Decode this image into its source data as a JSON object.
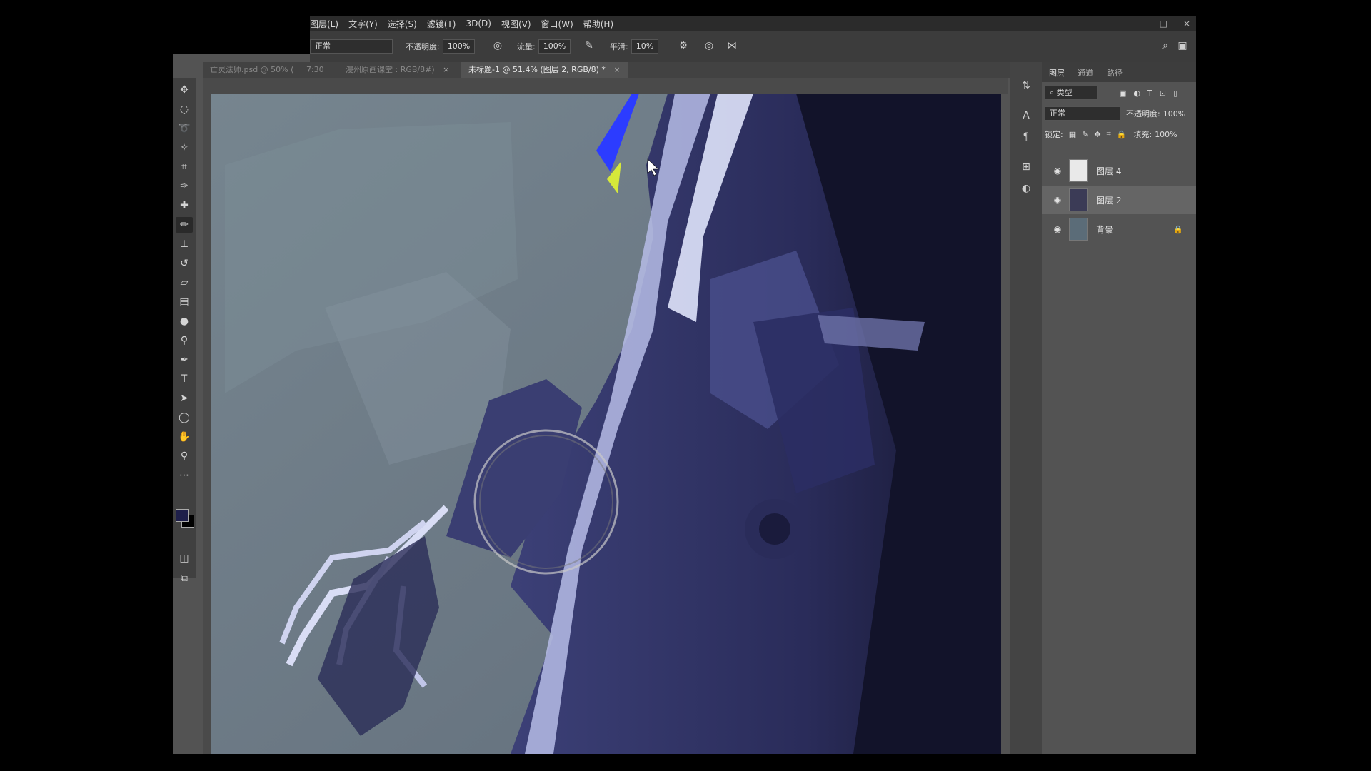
{
  "menu": [
    "图层(L)",
    "文字(Y)",
    "选择(S)",
    "滤镜(T)",
    "3D(D)",
    "视图(V)",
    "窗口(W)",
    "帮助(H)"
  ],
  "window_controls": [
    "–",
    "□",
    "×"
  ],
  "options": {
    "mode": "正常",
    "opacity_label": "不透明度:",
    "opacity_value": "100%",
    "flow_label": "流量:",
    "flow_value": "100%",
    "smoothing_label": "平滑:",
    "smoothing_value": "10%"
  },
  "tabs": [
    {
      "label": "亡灵法师.psd @ 50% (",
      "extra": "7:30"
    },
    {
      "label": "漫州原画课堂 : RGB/8#)",
      "close": "×"
    },
    {
      "label": "未标题-1 @ 51.4% (图层 2, RGB/8) *",
      "close": "×"
    }
  ],
  "layers_panel": {
    "tabs": [
      "图层",
      "通道",
      "路径"
    ],
    "filter_kind": "类型",
    "blend_mode": "正常",
    "opacity_label": "不透明度:",
    "opacity_value": "100%",
    "lock_label": "锁定:",
    "fill_label": "填充:",
    "fill_value": "100%",
    "layers": [
      {
        "name": "图层 4"
      },
      {
        "name": "图层 2"
      },
      {
        "name": "背景"
      }
    ]
  },
  "colors": {
    "foreground": "#1e1f4a",
    "background": "#000000"
  },
  "icons": {
    "tools": [
      "move-icon",
      "marquee-icon",
      "lasso-icon",
      "magic-wand-icon",
      "crop-icon",
      "eyedropper-icon",
      "healing-brush-icon",
      "brush-icon",
      "clone-stamp-icon",
      "history-brush-icon",
      "eraser-icon",
      "gradient-icon",
      "blur-icon",
      "dodge-icon",
      "pen-icon",
      "type-icon",
      "path-select-icon",
      "shape-icon",
      "hand-icon",
      "zoom-icon",
      "more-tools-icon"
    ]
  }
}
